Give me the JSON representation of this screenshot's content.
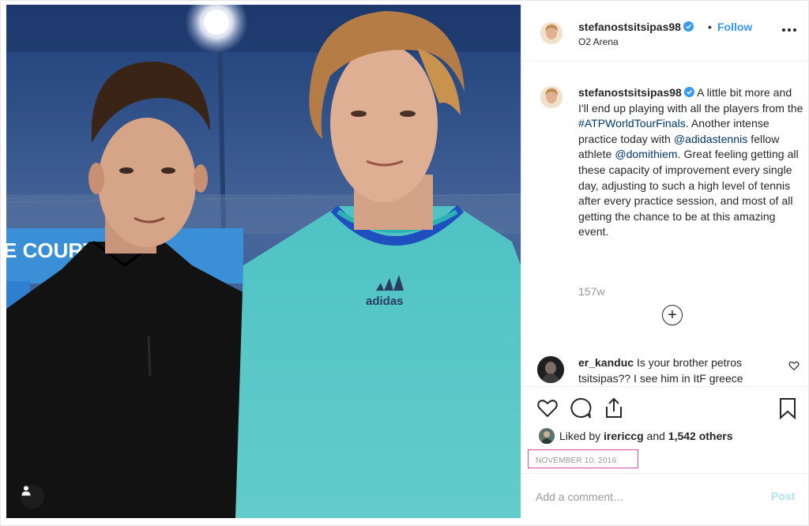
{
  "header": {
    "username": "stefanostsitsipas98",
    "follow_label": "Follow",
    "separator": "•",
    "location": "O2 Arena",
    "more_icon": "more-horizontal-icon"
  },
  "photo": {
    "court_sign_text": "E COURT 2",
    "shirt_logo_text": "adidas",
    "user_tag_icon": "user-tag-icon"
  },
  "caption": {
    "username": "stefanostsitsipas98",
    "text_1": "A little bit more and I'll end up playing with all the players from the ",
    "hashtag": "#ATPWorldTourFinals",
    "text_2": ". Another intense practice today with ",
    "mention_1": "@adidastennis",
    "text_3": " fellow athlete ",
    "mention_2": "@domithiem",
    "text_4": ". Great feeling getting all these capacity of improvement every single day, adjusting to such a high level of tennis after every practice session, and most of all getting the chance to be at this amazing event.",
    "time_ago": "157w"
  },
  "load_more_icon": "plus-circle-icon",
  "comment": {
    "username": "er_kanduc",
    "text": "Is your brother petros tsitsipas?? I see him in ItF greece"
  },
  "actions": {
    "like_icon": "heart-icon",
    "comment_icon": "comment-icon",
    "share_icon": "share-icon",
    "save_icon": "bookmark-icon"
  },
  "likes": {
    "prefix": "Liked by ",
    "user": "irericcg",
    "middle": " and ",
    "count": "1,542 others"
  },
  "date": "NOVEMBER 10, 2016",
  "add_comment": {
    "placeholder": "Add a comment…",
    "post_label": "Post"
  },
  "colors": {
    "link_blue": "#3897f0",
    "hashtag_navy": "#003569",
    "highlight_box": "#d44f9d",
    "muted": "#999999"
  }
}
